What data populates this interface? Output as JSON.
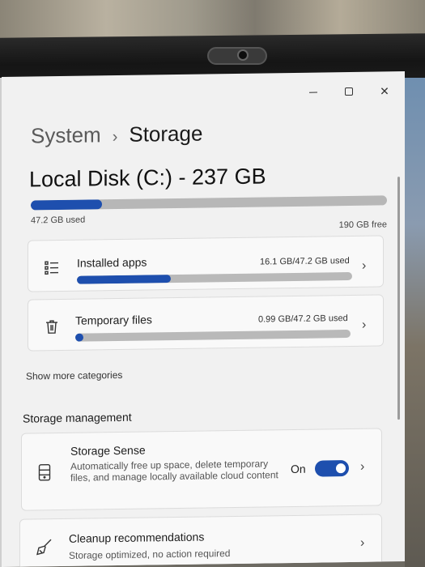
{
  "breadcrumb": {
    "parent": "System",
    "separator": "›",
    "current": "Storage"
  },
  "window_controls": {
    "close": "✕"
  },
  "disk": {
    "title": "Local Disk (C:) - 237 GB",
    "used_label": "47.2 GB used",
    "free_label": "190 GB free",
    "used_fraction": 0.2
  },
  "categories": [
    {
      "label": "Installed apps",
      "usage": "16.1 GB/47.2 GB used",
      "fraction": 0.34,
      "icon": "apps-list-icon"
    },
    {
      "label": "Temporary files",
      "usage": "0.99 GB/47.2 GB used",
      "fraction": 0.02,
      "icon": "trash-icon"
    }
  ],
  "show_more": "Show more categories",
  "storage_management": {
    "heading": "Storage management",
    "sense": {
      "title": "Storage Sense",
      "description": "Automatically free up space, delete temporary files, and manage locally available cloud content",
      "toggle_label": "On",
      "toggle_on": true
    },
    "cleanup": {
      "title": "Cleanup recommendations",
      "subtitle": "Storage optimized, no action required"
    }
  },
  "chevron": "›",
  "colors": {
    "accent": "#1e4fae",
    "track": "#b7b7b7"
  }
}
